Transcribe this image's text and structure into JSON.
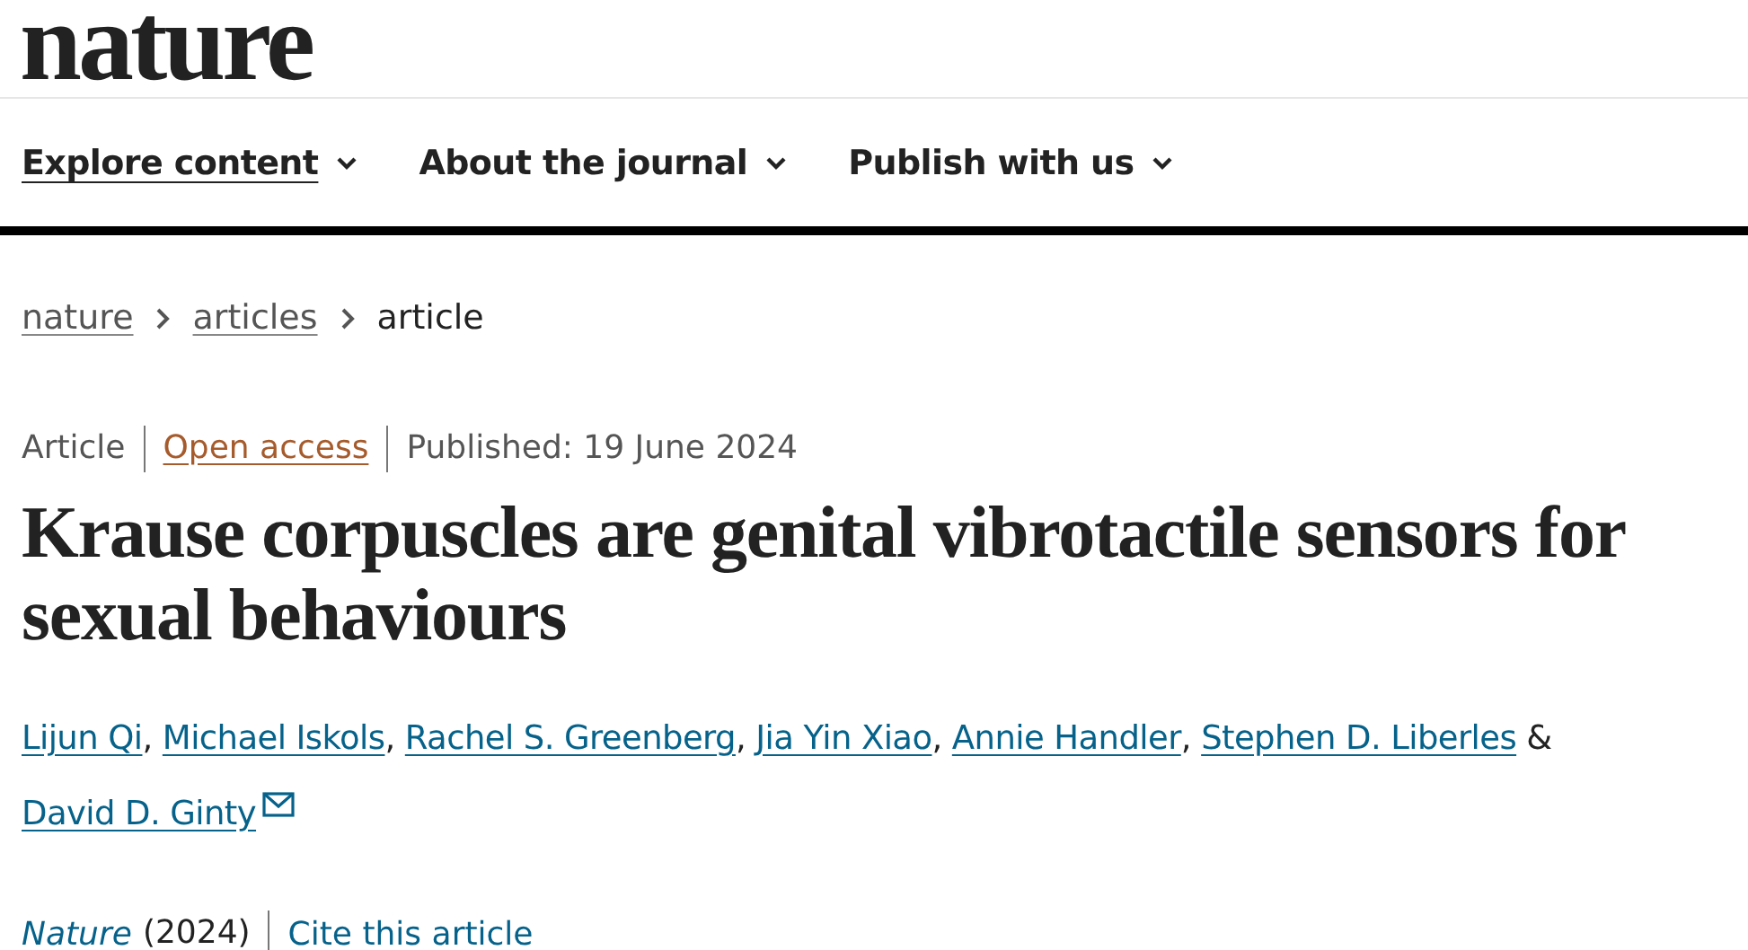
{
  "logo": "nature",
  "nav": [
    {
      "label": "Explore content",
      "selected": true
    },
    {
      "label": "About the journal",
      "selected": false
    },
    {
      "label": "Publish with us",
      "selected": false
    }
  ],
  "breadcrumb": [
    {
      "label": "nature",
      "kind": "link"
    },
    {
      "label": "articles",
      "kind": "link"
    },
    {
      "label": "article",
      "kind": "current"
    }
  ],
  "meta": [
    {
      "text": "Article",
      "kind": "text"
    },
    {
      "text": "Open access",
      "kind": "access"
    },
    {
      "text": "Published: 19 June 2024",
      "kind": "text"
    }
  ],
  "title": "Krause corpuscles are genital vibrotactile sensors for sexual behaviours",
  "authors": [
    {
      "name": "Lijun Qi",
      "sep": ","
    },
    {
      "name": "Michael Iskols",
      "sep": ","
    },
    {
      "name": "Rachel S. Greenberg",
      "sep": ","
    },
    {
      "name": "Jia Yin Xiao",
      "sep": ","
    },
    {
      "name": "Annie Handler",
      "sep": ","
    },
    {
      "name": "Stephen D. Liberles",
      "sep": "&"
    },
    {
      "name": "David D. Ginty",
      "email": true
    }
  ],
  "citation": {
    "journal": "Nature",
    "year": "(2024)",
    "cite": "Cite this article"
  }
}
